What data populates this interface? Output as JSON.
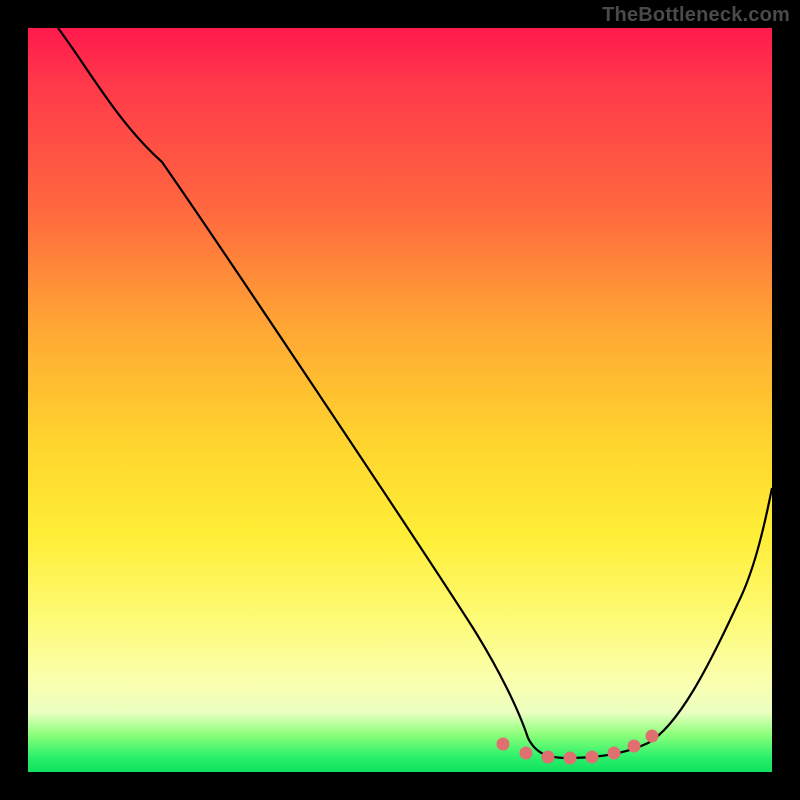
{
  "watermark": "TheBottleneck.com",
  "chart_data": {
    "type": "line",
    "title": "",
    "xlabel": "",
    "ylabel": "",
    "xlim": [
      0,
      100
    ],
    "ylim": [
      0,
      100
    ],
    "grid": false,
    "legend": false,
    "series": [
      {
        "name": "bottleneck-curve",
        "x": [
          4,
          10,
          18,
          26,
          34,
          42,
          50,
          56,
          60,
          63,
          66,
          70,
          74,
          78,
          82,
          86,
          90,
          94,
          100
        ],
        "y": [
          100,
          92,
          82,
          71,
          60,
          49,
          38,
          28,
          20,
          12,
          6,
          3,
          2,
          2,
          3,
          8,
          16,
          25,
          38
        ]
      }
    ],
    "markers": {
      "name": "optimum-dots",
      "color": "#e06c6c",
      "x": [
        63,
        66,
        69,
        72,
        75,
        78,
        81,
        84
      ],
      "y": [
        5,
        3.5,
        2.8,
        2.3,
        2.1,
        2.3,
        3.2,
        5
      ]
    },
    "gradient_stops": [
      {
        "pos": 0,
        "color": "#ff1a4d"
      },
      {
        "pos": 25,
        "color": "#ff6a3e"
      },
      {
        "pos": 55,
        "color": "#ffd32e"
      },
      {
        "pos": 80,
        "color": "#fdfb7a"
      },
      {
        "pos": 95,
        "color": "#8bff7a"
      },
      {
        "pos": 100,
        "color": "#10e05e"
      }
    ]
  }
}
